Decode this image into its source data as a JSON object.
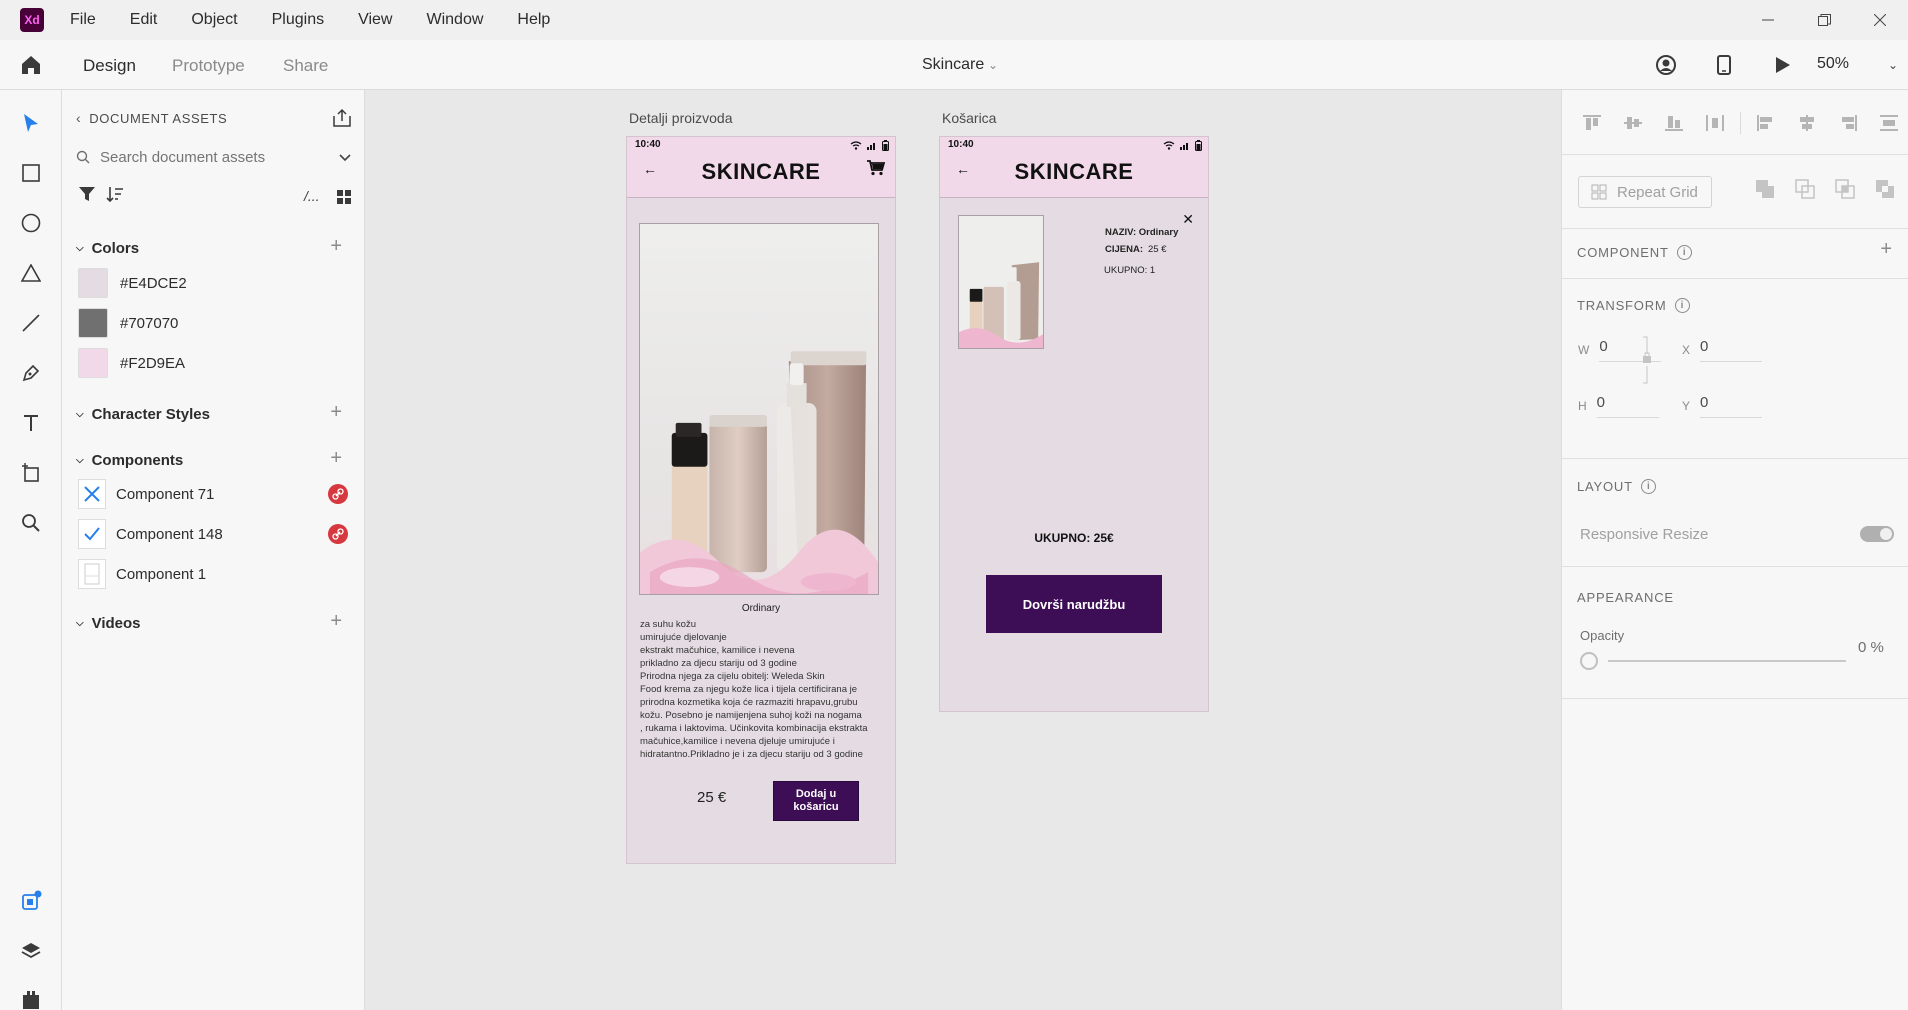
{
  "app": {
    "logo": "Xd",
    "document_title": "Skincare",
    "zoom": "50%"
  },
  "menu": [
    "File",
    "Edit",
    "Object",
    "Plugins",
    "View",
    "Window",
    "Help"
  ],
  "modes": {
    "design": "Design",
    "prototype": "Prototype",
    "share": "Share",
    "active": "Design"
  },
  "tools": [
    "select-tool",
    "rectangle-tool",
    "ellipse-tool",
    "polygon-tool",
    "line-tool",
    "pen-tool",
    "text-tool",
    "artboard-tool",
    "zoom-tool"
  ],
  "assets": {
    "header": "DOCUMENT ASSETS",
    "search_placeholder": "Search document assets",
    "colors_title": "Colors",
    "colors": [
      {
        "label": "#E4DCE2",
        "hex": "#E4DCE2"
      },
      {
        "label": "#707070",
        "hex": "#707070"
      },
      {
        "label": "#F2D9EA",
        "hex": "#F2D9EA"
      }
    ],
    "char_styles_title": "Character Styles",
    "components_title": "Components",
    "components": [
      {
        "label": "Component 71",
        "icon": "close-x-icon",
        "linked": true
      },
      {
        "label": "Component 148",
        "icon": "checkmark-icon",
        "linked": true
      },
      {
        "label": "Component 1",
        "icon": "blank-component-icon",
        "linked": false
      }
    ],
    "videos_title": "Videos"
  },
  "artboards": {
    "details": {
      "label": "Detalji proizvoda",
      "time": "10:40",
      "brand": "SKINCARE",
      "product_name": "Ordinary",
      "description": "za suhu kožu\numirujuće djelovanje\nekstrakt mačuhice, kamilice i nevena\nprikladno za djecu stariju od 3 godine\nPrirodna njega za cijelu obitelj: Weleda Skin\n Food krema za njegu kože lica i tijela certificirana je\n prirodna kozmetika koja će razmaziti hrapavu,grubu\n kožu. Posebno je namijenjena suhoj koži na nogama\n , rukama i laktovima. Učinkovita kombinacija ekstrakta\n mačuhice,kamilice i nevena djeluje umirujuće i\n hidratantno.Prikladno je i za djecu stariju od 3 godine",
      "price": "25 €",
      "add_button": "Dodaj u košaricu"
    },
    "cart": {
      "label": "Košarica",
      "time": "10:40",
      "brand": "SKINCARE",
      "name_line": "NAZIV: Ordinary",
      "price_label": "CIJENA:",
      "price_value": "25 €",
      "qty_line": "UKUPNO: 1",
      "total": "UKUPNO: 25€",
      "finish_button": "Dovrši narudžbu"
    }
  },
  "inspector": {
    "repeat_grid": "Repeat Grid",
    "component": "COMPONENT",
    "transform": "TRANSFORM",
    "w_label": "W",
    "w": "0",
    "h_label": "H",
    "h": "0",
    "x_label": "X",
    "x": "0",
    "y_label": "Y",
    "y": "0",
    "layout": "LAYOUT",
    "responsive_resize": "Responsive Resize",
    "appearance": "APPEARANCE",
    "opacity_label": "Opacity",
    "opacity_value": "0 %"
  },
  "colors": {
    "accent_blue": "#2680EB",
    "button_purple": "#3D0E56",
    "link_red": "#D7373F"
  }
}
